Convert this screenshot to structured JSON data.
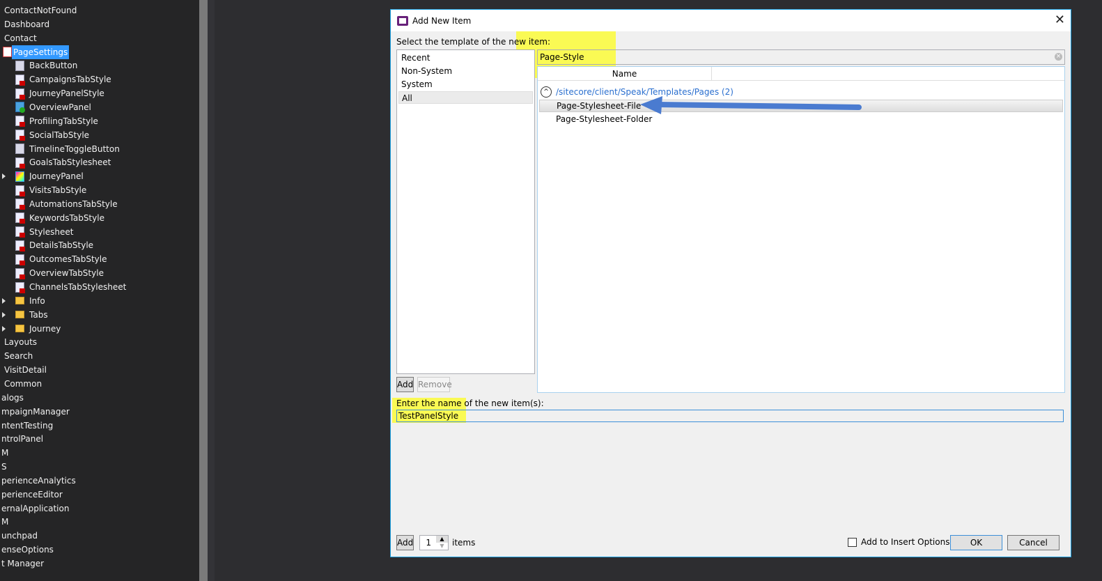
{
  "tree": [
    {
      "label": "ContactNotFound",
      "indent": 0,
      "icon": ""
    },
    {
      "label": "Dashboard",
      "indent": 0,
      "icon": ""
    },
    {
      "label": "Contact",
      "indent": 0,
      "icon": ""
    },
    {
      "label": "PageSettings",
      "indent": 1,
      "icon": "check",
      "selected": true
    },
    {
      "label": "BackButton",
      "indent": 2,
      "icon": "page"
    },
    {
      "label": "CampaignsTabStyle",
      "indent": 2,
      "icon": "css"
    },
    {
      "label": "JourneyPanelStyle",
      "indent": 2,
      "icon": "css"
    },
    {
      "label": "OverviewPanel",
      "indent": 2,
      "icon": "ok"
    },
    {
      "label": "ProfilingTabStyle",
      "indent": 2,
      "icon": "css"
    },
    {
      "label": "SocialTabStyle",
      "indent": 2,
      "icon": "css"
    },
    {
      "label": "TimelineToggleButton",
      "indent": 2,
      "icon": "page"
    },
    {
      "label": "GoalsTabStylesheet",
      "indent": 2,
      "icon": "css"
    },
    {
      "label": "JourneyPanel",
      "indent": 2,
      "icon": "grad",
      "expander": true
    },
    {
      "label": "VisitsTabStyle",
      "indent": 2,
      "icon": "css"
    },
    {
      "label": "AutomationsTabStyle",
      "indent": 2,
      "icon": "css"
    },
    {
      "label": "KeywordsTabStyle",
      "indent": 2,
      "icon": "css"
    },
    {
      "label": "Stylesheet",
      "indent": 2,
      "icon": "css"
    },
    {
      "label": "DetailsTabStyle",
      "indent": 2,
      "icon": "css"
    },
    {
      "label": "OutcomesTabStyle",
      "indent": 2,
      "icon": "css"
    },
    {
      "label": "OverviewTabStyle",
      "indent": 2,
      "icon": "css"
    },
    {
      "label": "ChannelsTabStylesheet",
      "indent": 2,
      "icon": "css"
    },
    {
      "label": "Info",
      "indent": 2,
      "icon": "folder",
      "expander": true
    },
    {
      "label": "Tabs",
      "indent": 2,
      "icon": "folder",
      "expander": true
    },
    {
      "label": "Journey",
      "indent": 2,
      "icon": "folder",
      "expander": true
    },
    {
      "label": "Layouts",
      "indent": 0,
      "icon": ""
    },
    {
      "label": "Search",
      "indent": 0,
      "icon": ""
    },
    {
      "label": "VisitDetail",
      "indent": 0,
      "icon": ""
    },
    {
      "label": "Common",
      "indent": 0,
      "icon": ""
    },
    {
      "label": "alogs",
      "indent": -1,
      "icon": ""
    },
    {
      "label": "mpaignManager",
      "indent": -1,
      "icon": ""
    },
    {
      "label": "ntentTesting",
      "indent": -1,
      "icon": ""
    },
    {
      "label": "ntrolPanel",
      "indent": -1,
      "icon": ""
    },
    {
      "label": "M",
      "indent": -1,
      "icon": ""
    },
    {
      "label": "S",
      "indent": -1,
      "icon": ""
    },
    {
      "label": "perienceAnalytics",
      "indent": -1,
      "icon": ""
    },
    {
      "label": "perienceEditor",
      "indent": -1,
      "icon": ""
    },
    {
      "label": "ernalApplication",
      "indent": -1,
      "icon": ""
    },
    {
      "label": "M",
      "indent": -1,
      "icon": ""
    },
    {
      "label": "unchpad",
      "indent": -1,
      "icon": ""
    },
    {
      "label": "enseOptions",
      "indent": -1,
      "icon": ""
    },
    {
      "label": "t Manager",
      "indent": -1,
      "icon": ""
    }
  ],
  "dialog": {
    "title": "Add New Item",
    "select_label": "Select the template of the new item:",
    "categories": [
      "Recent",
      "Non-System",
      "System",
      "All"
    ],
    "selected_category": "All",
    "search_value": "Page-Style",
    "column_name": "Name",
    "group": "/sitecore/client/Speak/Templates/Pages (2)",
    "results": [
      "Page-Stylesheet-File",
      "Page-Stylesheet-Folder"
    ],
    "add_label": "Add",
    "remove_label": "Remove",
    "name_label": "Enter the name of the new item(s):",
    "name_value": "TestPanelStyle",
    "add2_label": "Add",
    "count": "1",
    "items_label": "items",
    "insert_options_label": "Add to Insert Options",
    "insert_options_checked": false,
    "ok_label": "OK",
    "cancel_label": "Cancel"
  },
  "colors": {
    "accent": "#1ba1e2",
    "link": "#2a6fcf",
    "highlight": "#ffff00",
    "arrow": "#4a7bd0"
  }
}
